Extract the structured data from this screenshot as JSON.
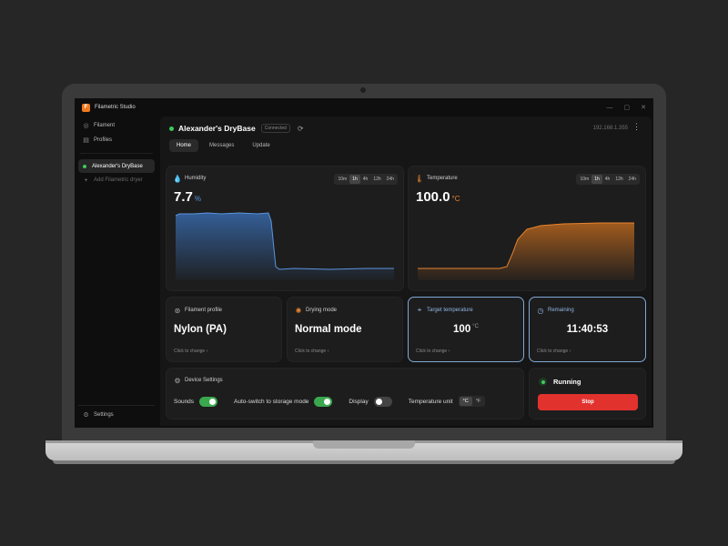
{
  "app": {
    "title": "Filametric Studio",
    "logo_letter": "F"
  },
  "window_controls": [
    "—",
    "▢",
    "✕"
  ],
  "sidebar": {
    "items": [
      {
        "label": "Filament",
        "icon": "target-icon"
      },
      {
        "label": "Profiles",
        "icon": "document-icon"
      }
    ],
    "device": "Alexander's DryBase",
    "add_label": "Add Filametric dryer",
    "settings_label": "Settings"
  },
  "device": {
    "name": "Alexander's DryBase",
    "status": "Connected",
    "ip": "192.168.1.355"
  },
  "tabs": [
    "Home",
    "Messages",
    "Update"
  ],
  "humidity": {
    "title": "Humidity",
    "value": "7.7",
    "unit": "%",
    "color": "#5b95e0",
    "ranges": [
      "10m",
      "1h",
      "4h",
      "12h",
      "24h"
    ],
    "active_range": "1h"
  },
  "temperature": {
    "title": "Temperature",
    "value": "100.0",
    "unit": "°C",
    "color": "#e8842e",
    "ranges": [
      "10m",
      "1h",
      "4h",
      "12h",
      "24h"
    ],
    "active_range": "1h"
  },
  "cards": {
    "filament": {
      "title": "Filament profile",
      "value": "Nylon (PA)",
      "action": "Click to change ›"
    },
    "drying": {
      "title": "Drying mode",
      "value": "Normal mode",
      "action": "Click to change ›"
    },
    "target": {
      "title": "Target temperature",
      "value": "100",
      "unit": "°C",
      "action": "Click to change ›"
    },
    "remaining": {
      "title": "Remaining",
      "value": "11:40:53",
      "action": "Click to change ›"
    }
  },
  "device_settings": {
    "title": "Device Settings",
    "sounds_label": "Sounds",
    "sounds_on": true,
    "autoswitch_label": "Auto-switch to storage mode",
    "autoswitch_on": true,
    "display_label": "Display",
    "display_on": false,
    "unit_label": "Temperature unit",
    "unit_options": [
      "°C",
      "°F"
    ],
    "unit_active": "°C"
  },
  "run": {
    "status": "Running",
    "stop_label": "Stop",
    "stop_color": "#e2322e"
  }
}
